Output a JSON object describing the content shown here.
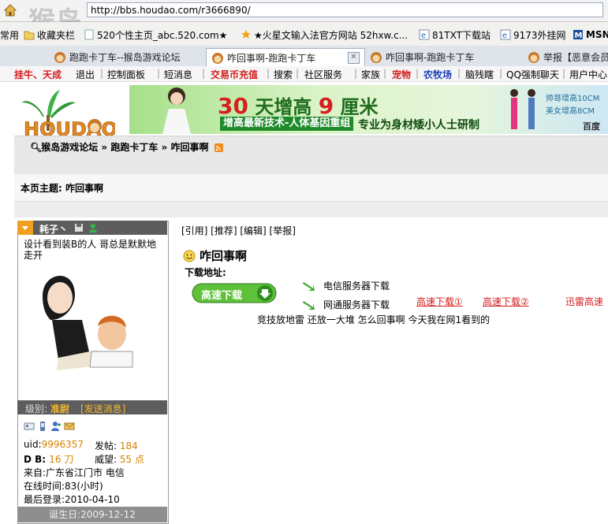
{
  "browser": {
    "url": "http://bbs.houdao.com/r3666890/",
    "watermark": {
      "big": "猴岛",
      "small": "bbs.houdao.com"
    },
    "bookmarks": [
      {
        "label": "常用"
      },
      {
        "label": "收藏夹栏"
      },
      {
        "label": "520个性主页_abc.520.com★"
      },
      {
        "label": "★火星文输入法官方网站 52hxw.c..."
      },
      {
        "label": "81TXT下载站"
      },
      {
        "label": "9173外挂网"
      },
      {
        "label": "MSN."
      }
    ],
    "tabs": [
      {
        "label": "跑跑卡丁车--猴岛游戏论坛"
      },
      {
        "label": "咋回事啊-跑跑卡丁车"
      },
      {
        "label": "咋回事啊-跑跑卡丁车"
      },
      {
        "label": "举报【恶意会员"
      }
    ]
  },
  "site_nav": {
    "items": [
      "挂牛、天成",
      "退出",
      "控制面板",
      "短消息",
      "交易币充值",
      "搜索",
      "社区服务",
      "家族",
      "宠物",
      "农牧场",
      "脑残瞎",
      "QQ强制聊天",
      "用户中心"
    ]
  },
  "banner": {
    "headline_pre": "30",
    "headline_mid": "天增高",
    "headline_num": "9",
    "headline_post": "厘米",
    "strip": "增高最新技术-人体基因重组",
    "slogan": "专业为身材矮小人士研制",
    "side_text_1": "帅哥增高10CM",
    "side_text_2": "美女增高8CM",
    "brand": "百度"
  },
  "breadcrumb": [
    "猴岛游戏论坛",
    "跑跑卡丁车",
    "咋回事啊"
  ],
  "topic": {
    "prefix": "本页主题:",
    "title": "咋回事啊"
  },
  "user": {
    "name": "耗子丶",
    "signature": "设计看到装B的人 哥总是默默地走开",
    "level_label": "级别:",
    "level_value": "准尉",
    "send_msg": "[发送消息]",
    "uid_label": "uid:",
    "uid_value": "9996357",
    "posts_label": "发帖:",
    "posts_value": "184",
    "db_label": "D B:",
    "db_value": "16 刀",
    "prestige_label": "威望:",
    "prestige_value": "55 点",
    "from": "来自:广东省江门市 电信",
    "online": "在线时间:83(小时)",
    "last_login": "最后登录:2010-04-10",
    "birthday": "诞生日:2009-12-12"
  },
  "post": {
    "actions": "[引用] [推荐] [编辑] [举报]",
    "title": "咋回事啊",
    "download_label": "下载地址:",
    "download_button": "高速下载",
    "server_telecom": "电信服务器下载",
    "server_netcom": "网通服务器下载",
    "fast1": "高速下载①",
    "fast2": "高速下载②",
    "xunlei": "迅雷高速",
    "body": "竞技放地雷  还放一大堆    怎么回事啊  今天我在网1看到的"
  },
  "colors": {
    "nav_red": "#d41c1c",
    "stat_orange": "#d48400",
    "header_gray": "#5d5d5d"
  }
}
